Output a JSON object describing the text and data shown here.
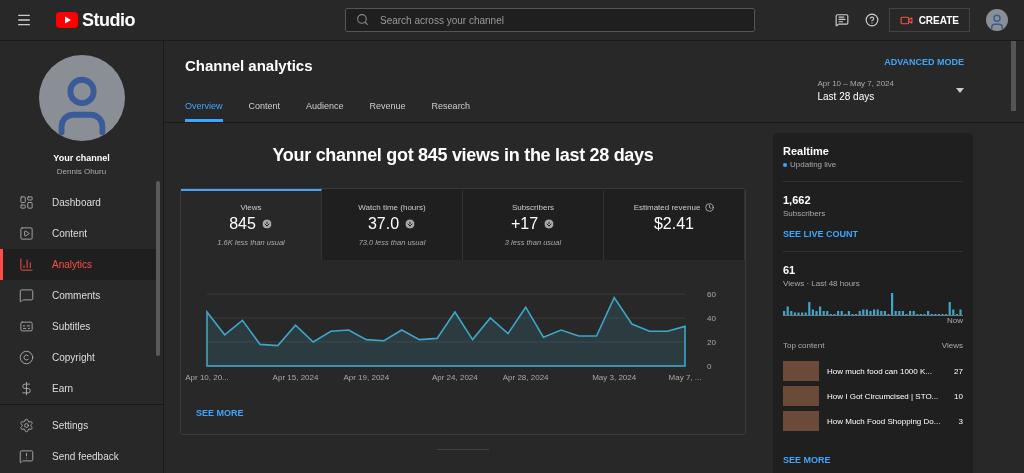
{
  "topbar": {
    "logo_text": "Studio",
    "search": {
      "placeholder": "Search across your channel"
    },
    "create_button": "CREATE"
  },
  "sidebar": {
    "channel_title": "Your channel",
    "channel_name": "Dennis Ohuru",
    "items": [
      {
        "label": "Dashboard",
        "selected": false
      },
      {
        "label": "Content",
        "selected": false
      },
      {
        "label": "Analytics",
        "selected": true
      },
      {
        "label": "Comments",
        "selected": false
      },
      {
        "label": "Subtitles",
        "selected": false
      },
      {
        "label": "Copyright",
        "selected": false
      },
      {
        "label": "Earn",
        "selected": false
      }
    ],
    "footer_items": [
      {
        "label": "Settings"
      },
      {
        "label": "Send feedback"
      }
    ]
  },
  "header": {
    "title": "Channel analytics",
    "advanced_mode": "ADVANCED MODE",
    "tabs": [
      {
        "label": "Overview",
        "selected": true
      },
      {
        "label": "Content",
        "selected": false
      },
      {
        "label": "Audience",
        "selected": false
      },
      {
        "label": "Revenue",
        "selected": false
      },
      {
        "label": "Research",
        "selected": false
      }
    ],
    "date_range": {
      "range": "Apr 10 – May 7, 2024",
      "label": "Last 28 days"
    }
  },
  "overview": {
    "headline": "Your channel got 845 views in the last 28 days",
    "metrics": [
      {
        "label": "Views",
        "value": "845",
        "note": "1.6K less than usual",
        "kind": "decrease",
        "selected": true
      },
      {
        "label": "Watch time (hours)",
        "value": "37.0",
        "note": "73.0 less than usual",
        "kind": "decrease",
        "selected": false
      },
      {
        "label": "Subscribers",
        "value": "+17",
        "note": "3 less than usual",
        "kind": "decrease",
        "selected": false
      },
      {
        "label": "Estimated revenue",
        "value": "$2.41",
        "kind": "estimated",
        "selected": false
      }
    ],
    "chart_data": {
      "type": "area",
      "categories": [
        "Apr 10, 20...",
        null,
        null,
        null,
        null,
        "Apr 15, 2024",
        null,
        null,
        null,
        "Apr 19, 2024",
        null,
        null,
        null,
        null,
        "Apr 24, 2024",
        null,
        null,
        null,
        "Apr 28, 2024",
        null,
        null,
        null,
        null,
        "May 3, 2024",
        null,
        null,
        null,
        "May 7, ..."
      ],
      "series": [
        {
          "color": "#3ea6c9",
          "values": [
            45,
            26,
            38,
            18,
            17,
            34,
            20,
            29,
            30,
            22,
            21,
            30,
            22,
            23,
            45,
            22,
            40,
            27,
            49,
            24,
            30,
            25,
            25,
            57,
            35,
            29,
            29,
            33
          ]
        }
      ],
      "ylim": [
        0,
        60
      ],
      "yticks": [
        0,
        20,
        40,
        60
      ]
    },
    "see_more": "SEE MORE"
  },
  "realtime": {
    "title": "Realtime",
    "status": "Updating live",
    "subscribers": "1,662",
    "subscribers_label": "Subscribers",
    "live_count_link": "SEE LIVE COUNT",
    "views": "61",
    "views_label": "Views · Last 48 hours",
    "now_label": "Now",
    "top_content_label": "Top content",
    "views_column": "Views",
    "top_content": [
      {
        "title": "How much food can 1000 K...",
        "views": "27"
      },
      {
        "title": "How I Got Circumcised | STO...",
        "views": "10"
      },
      {
        "title": "How Much Food Shopping Do...",
        "views": "3"
      }
    ],
    "see_more": "SEE MORE"
  }
}
